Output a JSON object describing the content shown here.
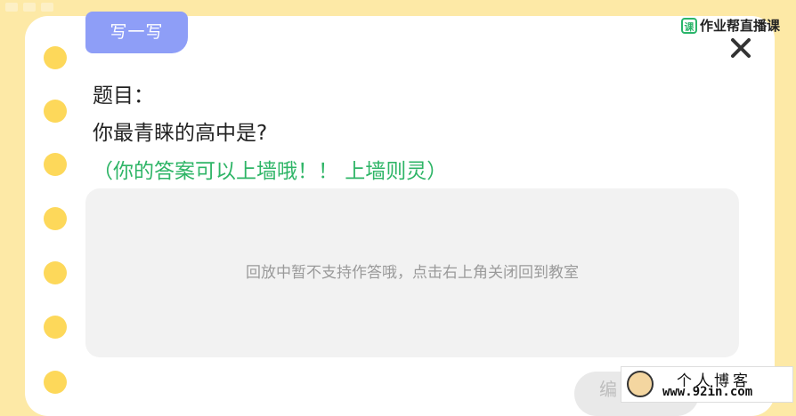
{
  "header": {
    "tab_label": "写一写",
    "brand_name": "作业帮直播课",
    "brand_logo_char": "课"
  },
  "question": {
    "label": "题目：",
    "text": "你最青睐的高中是?",
    "hint": "（你的答案可以上墙哦！！ 上墙则灵）"
  },
  "answer_area": {
    "message": "回放中暂不支持作答哦，点击右上角关闭回到教室"
  },
  "footer": {
    "edit_label": "编"
  },
  "watermark": {
    "title": "个人博客",
    "url": "www.92in.com"
  },
  "colors": {
    "background": "#fde9a6",
    "tab": "#8e9ef7",
    "hint": "#2fb567",
    "ring": "#fdd85a"
  }
}
